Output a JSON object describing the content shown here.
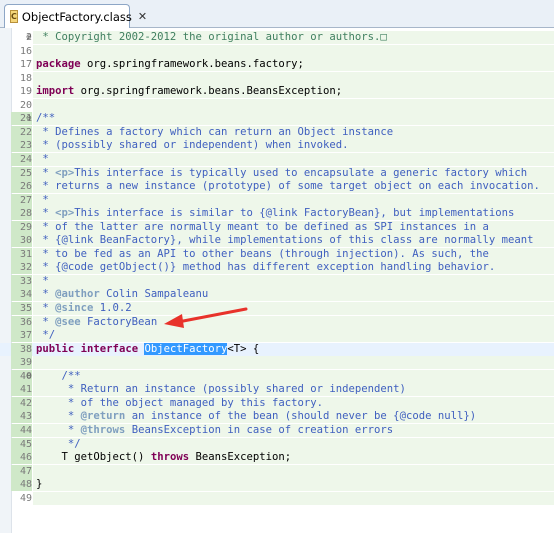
{
  "tab": {
    "label": "ObjectFactory.class",
    "close_glyph": "✕",
    "icon_letter": "C"
  },
  "editor": {
    "lines": [
      {
        "num": "2",
        "fold": "⊕",
        "segs": [
          {
            "t": " * Copyright 2002-2012 the original author or authors.",
            "c": "cm"
          },
          {
            "t": "□",
            "c": "cm"
          }
        ]
      },
      {
        "num": "16",
        "fold": "",
        "segs": []
      },
      {
        "num": "17",
        "fold": "",
        "segs": [
          {
            "t": "package",
            "c": "kw"
          },
          {
            "t": " org.springframework.beans.factory;",
            "c": "plain"
          }
        ]
      },
      {
        "num": "18",
        "fold": "",
        "segs": []
      },
      {
        "num": "19",
        "fold": "",
        "segs": [
          {
            "t": "import",
            "c": "kw"
          },
          {
            "t": " org.springframework.beans.BeansException;",
            "c": "plain"
          }
        ]
      },
      {
        "num": "20",
        "fold": "",
        "segs": []
      },
      {
        "num": "21",
        "fold": "⊖",
        "segs": [
          {
            "t": "/**",
            "c": "jd"
          }
        ]
      },
      {
        "num": "22",
        "fold": "",
        "segs": [
          {
            "t": " * Defines a factory which can return an Object instance",
            "c": "jd"
          }
        ]
      },
      {
        "num": "23",
        "fold": "",
        "segs": [
          {
            "t": " * (possibly shared or independent) when invoked.",
            "c": "jd"
          }
        ]
      },
      {
        "num": "24",
        "fold": "",
        "segs": [
          {
            "t": " *",
            "c": "jd"
          }
        ]
      },
      {
        "num": "25",
        "fold": "",
        "segs": [
          {
            "t": " * ",
            "c": "jd"
          },
          {
            "t": "<p>",
            "c": "tag"
          },
          {
            "t": "This interface is typically used to encapsulate a generic factory which",
            "c": "jd"
          }
        ]
      },
      {
        "num": "26",
        "fold": "",
        "segs": [
          {
            "t": " * returns a new instance (prototype) of some target object on each invocation.",
            "c": "jd"
          }
        ]
      },
      {
        "num": "27",
        "fold": "",
        "segs": [
          {
            "t": " *",
            "c": "jd"
          }
        ]
      },
      {
        "num": "28",
        "fold": "",
        "segs": [
          {
            "t": " * ",
            "c": "jd"
          },
          {
            "t": "<p>",
            "c": "tag"
          },
          {
            "t": "This interface is similar to {@link FactoryBean}, but implementations",
            "c": "jd"
          }
        ]
      },
      {
        "num": "29",
        "fold": "",
        "segs": [
          {
            "t": " * of the latter are normally meant to be defined as SPI instances in a",
            "c": "jd"
          }
        ]
      },
      {
        "num": "30",
        "fold": "",
        "segs": [
          {
            "t": " * {@link BeanFactory}, while implementations of this class are normally meant",
            "c": "jd"
          }
        ]
      },
      {
        "num": "31",
        "fold": "",
        "segs": [
          {
            "t": " * to be fed as an API to other beans (through injection). As such, the",
            "c": "jd"
          }
        ]
      },
      {
        "num": "32",
        "fold": "",
        "segs": [
          {
            "t": " * {@code getObject()} method has different exception handling behavior.",
            "c": "jd"
          }
        ]
      },
      {
        "num": "33",
        "fold": "",
        "segs": [
          {
            "t": " *",
            "c": "jd"
          }
        ]
      },
      {
        "num": "34",
        "fold": "",
        "segs": [
          {
            "t": " * ",
            "c": "jd"
          },
          {
            "t": "@author",
            "c": "tag"
          },
          {
            "t": " Colin Sampaleanu",
            "c": "jd"
          }
        ]
      },
      {
        "num": "35",
        "fold": "",
        "segs": [
          {
            "t": " * ",
            "c": "jd"
          },
          {
            "t": "@since",
            "c": "tag"
          },
          {
            "t": " 1.0.2",
            "c": "jd"
          }
        ]
      },
      {
        "num": "36",
        "fold": "",
        "segs": [
          {
            "t": " * ",
            "c": "jd"
          },
          {
            "t": "@see",
            "c": "tag"
          },
          {
            "t": " FactoryBean",
            "c": "jd"
          }
        ]
      },
      {
        "num": "37",
        "fold": "",
        "segs": [
          {
            "t": " */",
            "c": "jd"
          }
        ]
      },
      {
        "num": "38",
        "fold": "",
        "current": true,
        "segs": [
          {
            "t": "public",
            "c": "kw"
          },
          {
            "t": " ",
            "c": "plain"
          },
          {
            "t": "interface",
            "c": "kw"
          },
          {
            "t": " ",
            "c": "plain"
          },
          {
            "t": "ObjectFactory",
            "c": "hl"
          },
          {
            "t": "<T> {",
            "c": "plain"
          }
        ]
      },
      {
        "num": "39",
        "fold": "",
        "segs": []
      },
      {
        "num": "40",
        "fold": "⊖",
        "segs": [
          {
            "t": "    /**",
            "c": "jd"
          }
        ]
      },
      {
        "num": "41",
        "fold": "",
        "segs": [
          {
            "t": "     * Return an instance (possibly shared or independent)",
            "c": "jd"
          }
        ]
      },
      {
        "num": "42",
        "fold": "",
        "segs": [
          {
            "t": "     * of the object managed by this factory.",
            "c": "jd"
          }
        ]
      },
      {
        "num": "43",
        "fold": "",
        "segs": [
          {
            "t": "     * ",
            "c": "jd"
          },
          {
            "t": "@return",
            "c": "tag"
          },
          {
            "t": " an instance of the bean (should never be {@code null})",
            "c": "jd"
          }
        ]
      },
      {
        "num": "44",
        "fold": "",
        "segs": [
          {
            "t": "     * ",
            "c": "jd"
          },
          {
            "t": "@throws",
            "c": "tag"
          },
          {
            "t": " BeansException in case of creation errors",
            "c": "jd"
          }
        ]
      },
      {
        "num": "45",
        "fold": "",
        "segs": [
          {
            "t": "     */",
            "c": "jd"
          }
        ]
      },
      {
        "num": "46",
        "fold": "",
        "segs": [
          {
            "t": "    T getObject() ",
            "c": "plain"
          },
          {
            "t": "throws",
            "c": "kw"
          },
          {
            "t": " BeansException;",
            "c": "plain"
          }
        ]
      },
      {
        "num": "47",
        "fold": "",
        "segs": []
      },
      {
        "num": "48",
        "fold": "",
        "segs": [
          {
            "t": "}",
            "c": "plain"
          }
        ]
      },
      {
        "num": "49",
        "fold": "",
        "segs": []
      }
    ]
  },
  "colors": {
    "keyword": "#7f0055",
    "javadoc": "#3f5fbf",
    "comment": "#3f7f5f",
    "selection": "#3399ff",
    "arrow": "#e8322b"
  }
}
